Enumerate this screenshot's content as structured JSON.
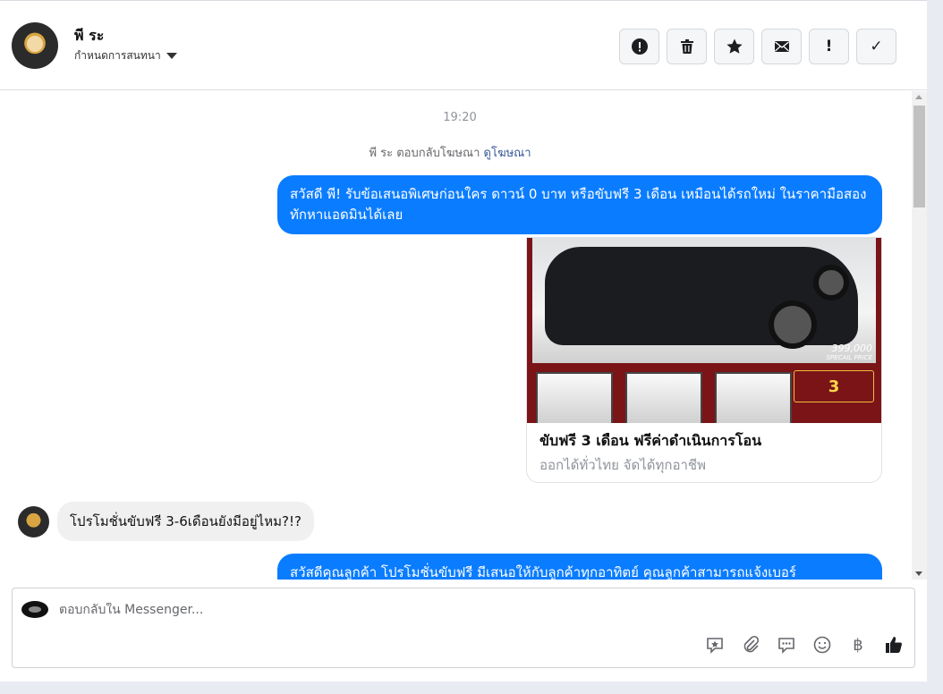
{
  "header": {
    "name": "พี ระ",
    "assign_label": "กำหนดการสนทนา",
    "actions": [
      {
        "name": "report-button",
        "icon": "exclamation-circle-icon"
      },
      {
        "name": "delete-button",
        "icon": "trash-icon"
      },
      {
        "name": "star-button",
        "icon": "star-icon"
      },
      {
        "name": "mark-unread-button",
        "icon": "envelope-icon"
      },
      {
        "name": "mark-spam-button",
        "icon": "exclamation-icon",
        "glyph": "!"
      },
      {
        "name": "mark-done-button",
        "icon": "check-icon",
        "glyph": "✓"
      }
    ]
  },
  "chat": {
    "timestamp": "19:20",
    "ad_reply_text": "พี ระ ตอบกลับโฆษณา",
    "ad_reply_link": "ดูโฆษณา",
    "outgoing_message_1": "สวัสดี พี! รับข้อเสนอพิเศษก่อนใคร ดาวน์ 0 บาท หรือขับฟรี 3 เดือน เหมือนได้รถใหม่ ในราคามือสอง ทักหาแอดมินได้เลย",
    "ad_card": {
      "price": "399,000",
      "price_caption": "SPECAIL PRICE",
      "badge_number": "3",
      "title": "ขับฟรี 3 เดือน ฟรีค่าดำเนินการโอน",
      "subtitle": "ออกได้ทั่วไทย จัดได้ทุกอาชีพ"
    },
    "incoming_message_1": "โปรโมชั่นขับฟรี 3-6เดือนยังมีอยู่ไหม?!?",
    "outgoing_message_2": "สวัสดีคุณลูกค้า โปรโมชั่นขับฟรี มีเสนอให้กับลูกค้าทุกอาทิตย์ คุณลูกค้าสามารถแจ้งเบอร์"
  },
  "composer": {
    "placeholder": "ตอบกลับใน Messenger...",
    "tools": [
      "saved-reply-icon",
      "attachment-icon",
      "quick-reply-icon",
      "emoji-icon",
      "baht-icon",
      "like-icon"
    ],
    "baht_glyph": "฿"
  },
  "colors": {
    "outgoing_bubble": "#0a7cff",
    "incoming_bubble": "#f0f0f0",
    "link": "#385898"
  }
}
